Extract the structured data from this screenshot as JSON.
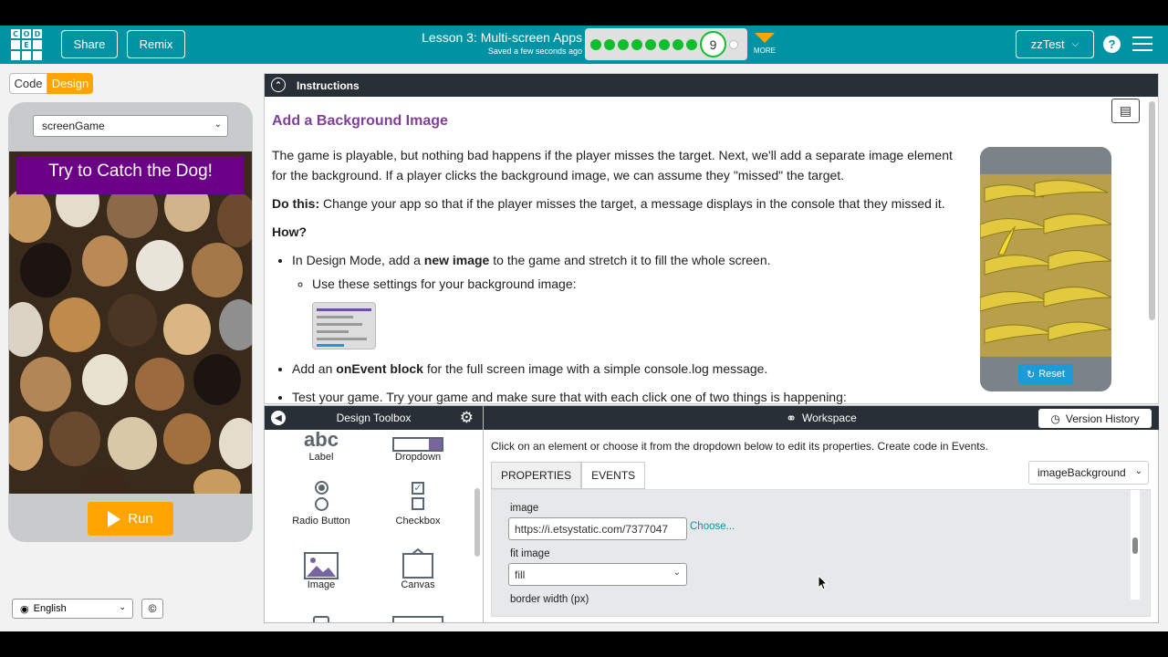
{
  "header": {
    "logo_letters": [
      "C",
      "O",
      "D",
      "",
      "E",
      ""
    ],
    "share_label": "Share",
    "remix_label": "Remix",
    "lesson_title": "Lesson 3: Multi-screen Apps",
    "save_status": "Saved a few seconds ago",
    "current_level": "9",
    "more_label": "MORE",
    "user_label": "zzTest",
    "help_label": "?"
  },
  "mode": {
    "code_label": "Code",
    "design_label": "Design"
  },
  "app": {
    "screen_select": "screenGame",
    "title_text": "Try to Catch the Dog!",
    "run_label": "Run"
  },
  "footer": {
    "language": "English",
    "copyright": "©"
  },
  "instructions": {
    "header": "Instructions",
    "title": "Add a Background Image",
    "para1": "The game is playable, but nothing bad happens if the player misses the target. Next, we'll add a separate image element for the background. If a player clicks the background image, we can assume they \"missed\" the target.",
    "do_this_bold": "Do this:",
    "do_this_text": " Change your app so that if the player misses the target, a message displays in the console that they missed it.",
    "how": "How?",
    "b1_pre": "In Design Mode, add a ",
    "b1_bold": "new image",
    "b1_post": " to the game and stretch it to fill the whole screen.",
    "b1_sub": "Use these settings for your background image:",
    "b2_pre": "Add an ",
    "b2_bold": "onEvent block",
    "b2_post": " for the full screen image with a simple console.log message.",
    "b3": "Test your game. Try your game and make sure that with each click one of two things is happening:",
    "reset_label": "Reset"
  },
  "toolbox": {
    "title": "Design Toolbox",
    "items": [
      {
        "label": "Label",
        "icon": "abc"
      },
      {
        "label": "Dropdown"
      },
      {
        "label": "Radio Button"
      },
      {
        "label": "Checkbox"
      },
      {
        "label": "Image"
      },
      {
        "label": "Canvas"
      }
    ]
  },
  "workspace": {
    "title": "Workspace",
    "version_history": "Version History",
    "message": "Click on an element or choose it from the dropdown below to edit its properties. Create code in Events.",
    "tab_properties": "PROPERTIES",
    "tab_events": "EVENTS",
    "element_select": "imageBackground",
    "image_label": "image",
    "image_value": "https://i.etsystatic.com/7377047",
    "choose_label": "Choose...",
    "fit_label": "fit image",
    "fit_value": "fill",
    "border_label": "border width (px)"
  },
  "colors": {
    "header": "#0093a4",
    "accent": "#ffa400",
    "progress_done": "#0fbd2d",
    "title_purple": "#6b0086"
  }
}
